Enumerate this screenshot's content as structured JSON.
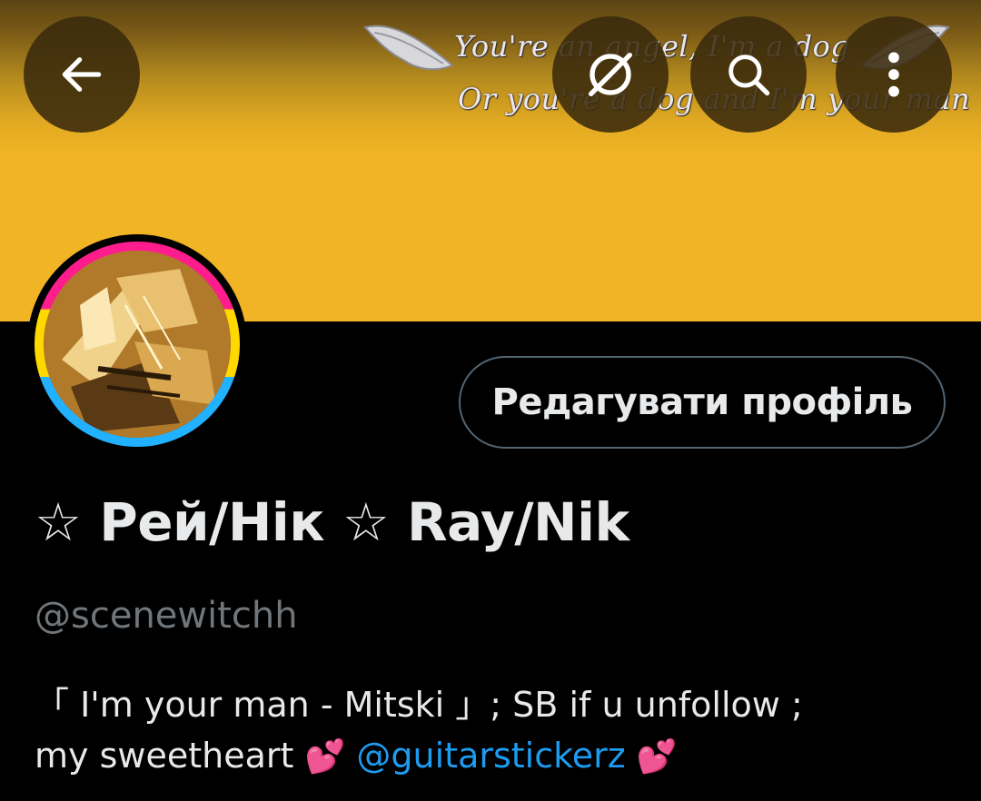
{
  "banner": {
    "lyrics_line1": "You're an angel, I'm a dog",
    "lyrics_line2": "Or you're a dog and I'm your man",
    "colors": {
      "top": "#5b4414",
      "bottom": "#f0b424"
    }
  },
  "topbar": {
    "back_icon": "arrow-left-icon",
    "grok_icon": "grok-icon",
    "search_icon": "search-icon",
    "more_icon": "more-vertical-icon"
  },
  "profile": {
    "edit_button_label": "Редагувати профіль",
    "display_name": "☆ Рей/Нік ☆ Ray/Nik",
    "handle": "@scenewitchh",
    "bio_line1": "「 I'm your man - Mitski 」; SB if u unfollow ;",
    "bio_line2_text": "my sweetheart",
    "bio_emoji": "💕",
    "bio_mention": "@guitarstickerz",
    "avatar_ring_colors": [
      "#ff1d8d",
      "#ffd800",
      "#21b1ff"
    ]
  },
  "colors": {
    "background": "#000000",
    "text_primary": "#e7e9ea",
    "text_secondary": "#71767b",
    "link": "#1d9bf0",
    "button_border": "#536471"
  }
}
